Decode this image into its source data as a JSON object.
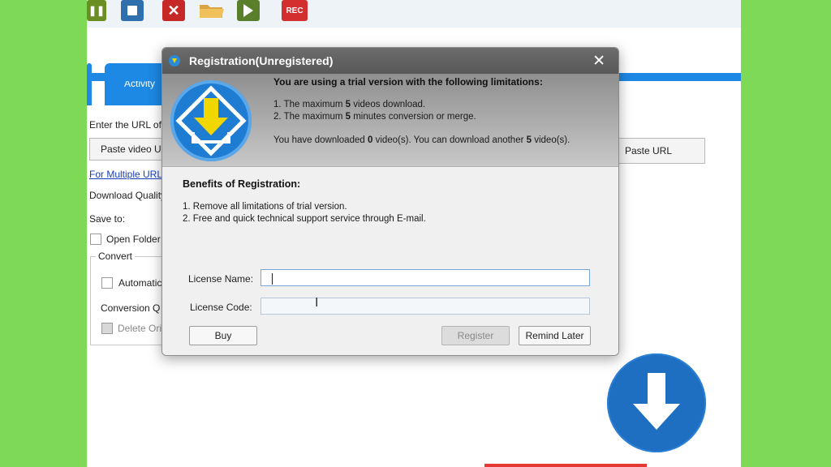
{
  "toolbar": {
    "buttons": [
      {
        "icon": "pause-icon"
      },
      {
        "icon": "stop-icon"
      },
      {
        "icon": "delete-icon",
        "glyph": "✕"
      },
      {
        "icon": "folder-icon"
      },
      {
        "icon": "play-icon"
      },
      {
        "icon": "record-icon",
        "label": "REC"
      }
    ]
  },
  "tabs": {
    "activity_label": "Activity"
  },
  "background": {
    "enter_url_label": "Enter the URL of",
    "paste_video_label": "Paste video U",
    "paste_url_label": "Paste URL",
    "multiple_urls_link": "For Multiple URLs",
    "download_quality_label": "Download Quality",
    "save_to_label": "Save to:",
    "open_folder_label": "Open Folder",
    "convert_group_label": "Convert",
    "automatic_label": "Automatic",
    "conversion_quality_label": "Conversion Q",
    "delete_original_label": "Delete Ori"
  },
  "dialog": {
    "title": "Registration(Unregistered)",
    "close_glyph": "✕",
    "limitations_title": "You are using a trial version with the following limitations:",
    "limit_1_prefix": "1. The maximum ",
    "limit_1_value": "5",
    "limit_1_suffix": " videos download.",
    "limit_2_prefix": "2. The maximum ",
    "limit_2_value": "5",
    "limit_2_suffix": " minutes conversion or merge.",
    "downloaded_prefix": "You have downloaded ",
    "downloaded_count": "0",
    "downloaded_middle": " video(s). You can download another ",
    "remaining_count": "5",
    "downloaded_suffix": " video(s).",
    "benefits_title": "Benefits of Registration:",
    "benefit_1": "1. Remove all limitations of trial version.",
    "benefit_2": "2. Free and quick technical support service through E-mail.",
    "license_name_label": "License Name:",
    "license_name_value": "",
    "license_code_label": "License Code:",
    "license_code_value": "",
    "buy_label": "Buy",
    "register_label": "Register",
    "remind_later_label": "Remind Later"
  },
  "colors": {
    "frame_green": "#7ed957",
    "accent_blue": "#1e88e5",
    "dialog_header_gray": "#8f8f8f",
    "logo_yellow": "#f2d600"
  }
}
